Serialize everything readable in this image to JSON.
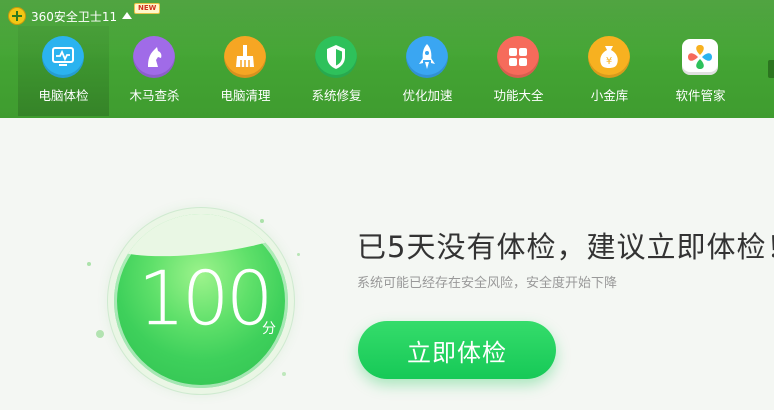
{
  "app": {
    "title": "360安全卫士11",
    "new_badge": "NEW",
    "accent_color": "#3f9c2f"
  },
  "nav": [
    {
      "label": "电脑体检",
      "icon": "monitor-check-icon",
      "color": "#2bb3ef",
      "active": true
    },
    {
      "label": "木马查杀",
      "icon": "horse-icon",
      "color": "#a06be8",
      "active": false
    },
    {
      "label": "电脑清理",
      "icon": "broom-icon",
      "color": "#f6a623",
      "active": false
    },
    {
      "label": "系统修复",
      "icon": "shield-icon",
      "color": "#2ec15b",
      "active": false
    },
    {
      "label": "优化加速",
      "icon": "rocket-icon",
      "color": "#3aa6f2",
      "active": false
    },
    {
      "label": "功能大全",
      "icon": "grid-icon",
      "color": "#f66b5b",
      "active": false
    },
    {
      "label": "小金库",
      "icon": "money-bag-icon",
      "color": "#f7b120",
      "active": false
    },
    {
      "label": "软件管家",
      "icon": "app-store-icon",
      "color": "#ffffff",
      "active": false
    }
  ],
  "score": {
    "value": "100",
    "unit": "分"
  },
  "message": {
    "headline": "已5天没有体检，建议立即体检！",
    "subline": "系统可能已经存在安全风险，安全度开始下降"
  },
  "action": {
    "check_button": "立即体检",
    "button_color": "#1ecb5d"
  }
}
